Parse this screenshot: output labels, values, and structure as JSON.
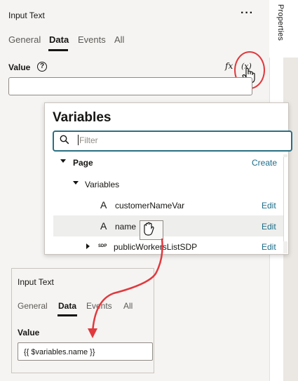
{
  "panel": {
    "title": "Input Text",
    "more_icon": "more-icon",
    "tabs": [
      {
        "label": "General"
      },
      {
        "label": "Data"
      },
      {
        "label": "Events"
      },
      {
        "label": "All"
      }
    ],
    "active_tab": "Data",
    "value_label": "Value",
    "help_glyph": "?",
    "value_input": "",
    "fx_label": "fx",
    "variables_button_label": "(x)"
  },
  "rail": {
    "label": "Properties"
  },
  "variables_popup": {
    "title": "Variables",
    "filter_placeholder": "Filter",
    "rows": [
      {
        "label": "Page",
        "action": "Create",
        "icon": "caret-down-icon"
      },
      {
        "label": "Variables",
        "action": "",
        "icon": "caret-down-icon"
      },
      {
        "label": "customerNameVar",
        "action": "Edit",
        "icon": "string-type-icon",
        "type_glyph": "A"
      },
      {
        "label": "name",
        "action": "Edit",
        "icon": "string-type-icon",
        "type_glyph": "A"
      },
      {
        "label": "publicWorkersListSDP",
        "action": "Edit",
        "icon": "sdp-icon",
        "type_glyph": "SDP"
      }
    ]
  },
  "inset_panel": {
    "title": "Input Text",
    "tabs": [
      {
        "label": "General"
      },
      {
        "label": "Data"
      },
      {
        "label": "Events"
      },
      {
        "label": "All"
      }
    ],
    "active_tab": "Data",
    "value_label": "Value",
    "value_input": "{{ $variables.name }}"
  },
  "colors": {
    "accent": "#1b6c88",
    "focus": "#2a6f83",
    "annotation_red": "#e0393e",
    "background": "#f5f4f2"
  }
}
